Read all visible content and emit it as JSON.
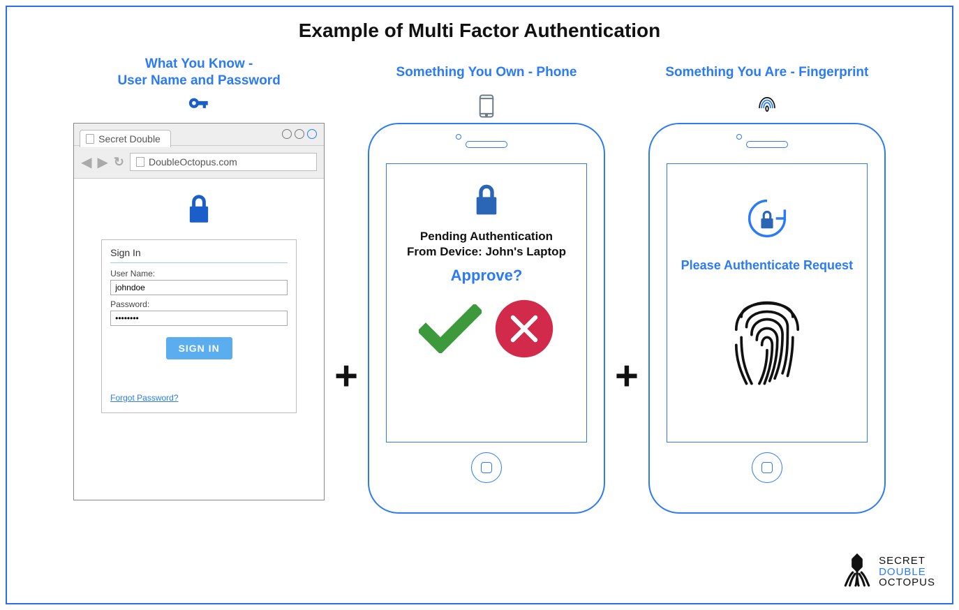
{
  "title": "Example of Multi Factor Authentication",
  "cols": {
    "know": {
      "heading_l1": "What You Know -",
      "heading_l2": "User Name and Password",
      "tab_label": "Secret Double",
      "url": "DoubleOctopus.com",
      "signin_title": "Sign In",
      "username_label": "User Name:",
      "username_value": "johndoe",
      "password_label": "Password:",
      "password_value": "********",
      "signin_button": "SIGN IN",
      "forgot": "Forgot Password?"
    },
    "own": {
      "heading": "Something You Own - Phone",
      "pending_l1": "Pending Authentication",
      "pending_l2": "From Device: John's Laptop",
      "approve": "Approve?"
    },
    "are": {
      "heading": "Something You Are - Fingerprint",
      "auth_text": "Please Authenticate Request"
    }
  },
  "footer": {
    "line1": "SECRET",
    "line2": "DOUBLE",
    "line3": "OCTOPUS"
  }
}
